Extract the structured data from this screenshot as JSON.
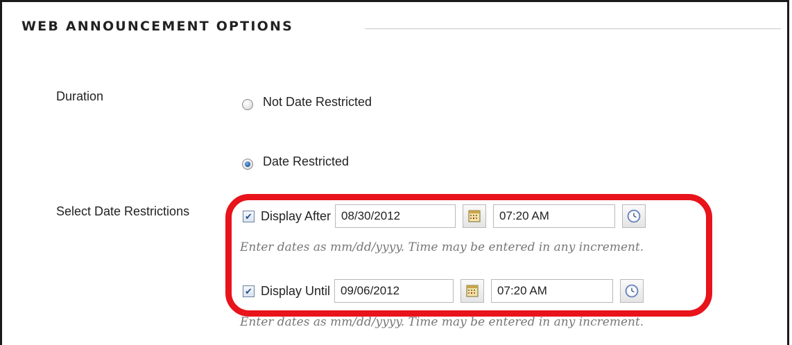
{
  "section": {
    "title": "WEB ANNOUNCEMENT OPTIONS"
  },
  "duration": {
    "label": "Duration",
    "options": [
      {
        "label": "Not Date Restricted",
        "selected": false
      },
      {
        "label": "Date Restricted",
        "selected": true
      }
    ]
  },
  "restrictions": {
    "label": "Select Date Restrictions",
    "display_after": {
      "label": "Display After",
      "checked": true,
      "date": "08/30/2012",
      "time": "07:20 AM"
    },
    "display_until": {
      "label": "Display Until",
      "checked": true,
      "date": "09/06/2012",
      "time": "07:20 AM"
    },
    "hint": "Enter dates as mm/dd/yyyy. Time may be entered in any increment."
  },
  "icons": {
    "calendar": "calendar-icon",
    "clock": "clock-icon"
  },
  "colors": {
    "highlight": "#e8131b",
    "radio_selected": "#1e5aa8",
    "hint_text": "#777777"
  }
}
